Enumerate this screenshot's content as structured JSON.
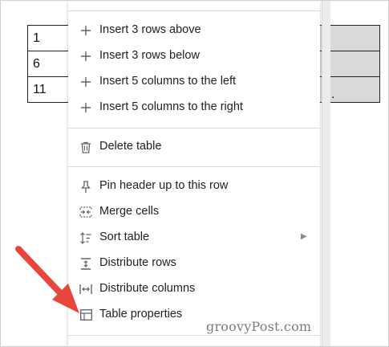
{
  "table": {
    "rows": [
      {
        "first": "1"
      },
      {
        "first": "6"
      },
      {
        "first": "11"
      }
    ],
    "trailing_char": "."
  },
  "menu": {
    "items": [
      {
        "icon": "plus-icon",
        "label": "Insert 3 rows above"
      },
      {
        "icon": "plus-icon",
        "label": "Insert 3 rows below"
      },
      {
        "icon": "plus-icon",
        "label": "Insert 5 columns to the left"
      },
      {
        "icon": "plus-icon",
        "label": "Insert 5 columns to the right"
      },
      {
        "icon": "trash-icon",
        "label": "Delete table"
      },
      {
        "icon": "pin-icon",
        "label": "Pin header up to this row"
      },
      {
        "icon": "merge-cells-icon",
        "label": "Merge cells"
      },
      {
        "icon": "sort-icon",
        "label": "Sort table",
        "has_submenu": true
      },
      {
        "icon": "distribute-rows-icon",
        "label": "Distribute rows"
      },
      {
        "icon": "distribute-columns-icon",
        "label": "Distribute columns"
      },
      {
        "icon": "table-properties-icon",
        "label": "Table properties"
      }
    ],
    "submenu_arrow": "▶"
  },
  "watermark": "groovyPost.com",
  "colors": {
    "highlight_cell": "#d9d9d9",
    "arrow": "#e8453c",
    "menu_text": "#202124",
    "icon": "#5f6368"
  }
}
